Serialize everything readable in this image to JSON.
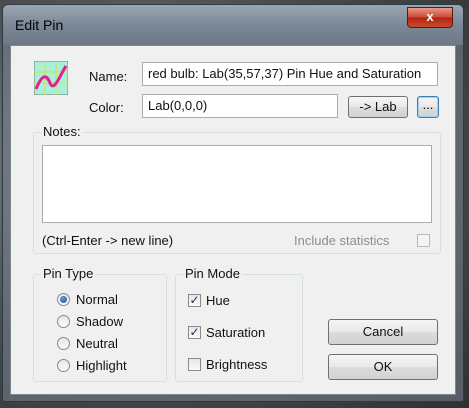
{
  "window": {
    "title": "Edit Pin",
    "close_glyph": "x"
  },
  "pin_icon": {
    "icon": "pin-curve-icon",
    "colors": {
      "bg": "#a8f0d8",
      "curve": "#e0209a",
      "grid": "#dddd44"
    }
  },
  "name": {
    "label": "Name:",
    "value": "red bulb: Lab(35,57,37) Pin Hue and Saturation"
  },
  "color": {
    "label": "Color:",
    "value": "Lab(0,0,0)",
    "to_lab_button": "-> Lab",
    "more_button": "..."
  },
  "notes": {
    "label": "Notes:",
    "value": "",
    "hint": "(Ctrl-Enter -> new line)",
    "include_statistics": "Include statistics"
  },
  "pin_type": {
    "title": "Pin Type",
    "options": [
      "Normal",
      "Shadow",
      "Neutral",
      "Highlight"
    ],
    "selected": "Normal"
  },
  "pin_mode": {
    "title": "Pin Mode",
    "options": [
      {
        "label": "Hue",
        "checked": true
      },
      {
        "label": "Saturation",
        "checked": true
      },
      {
        "label": "Brightness",
        "checked": false
      }
    ]
  },
  "buttons": {
    "cancel": "Cancel",
    "ok": "OK"
  }
}
